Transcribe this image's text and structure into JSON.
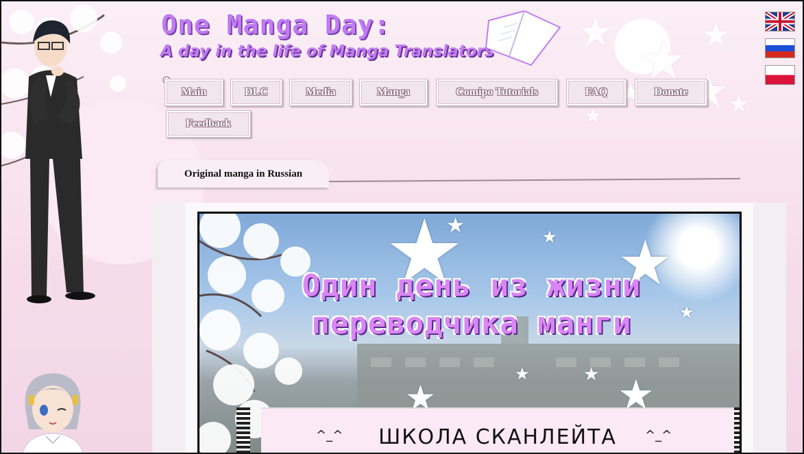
{
  "site": {
    "title": "One Manga Day:",
    "subtitle": "A day in the life of Manga Translators"
  },
  "languages": [
    {
      "name": "English",
      "icon": "uk-flag-icon"
    },
    {
      "name": "Russian",
      "icon": "russia-flag-icon"
    },
    {
      "name": "Polish",
      "icon": "poland-flag-icon"
    }
  ],
  "nav": {
    "items": [
      {
        "label": "Main"
      },
      {
        "label": "DLC"
      },
      {
        "label": "Media"
      },
      {
        "label": "Manga"
      },
      {
        "label": "Comipo Tutorials"
      },
      {
        "label": "FAQ"
      },
      {
        "label": "Donate"
      },
      {
        "label": "Feedback"
      }
    ]
  },
  "section": {
    "tab_label": "Original manga in Russian"
  },
  "manga": {
    "title_line1": "Один день из жизни",
    "title_line2": "переводчика манги",
    "banner_text": "ШКОЛА СКАНЛЕЙТА",
    "face_left": "^_^",
    "face_right": "^_^"
  },
  "colors": {
    "title_purple": "#c07cf0",
    "background_pink": "#f7e4f0",
    "manga_title_pink": "#d987f5"
  }
}
